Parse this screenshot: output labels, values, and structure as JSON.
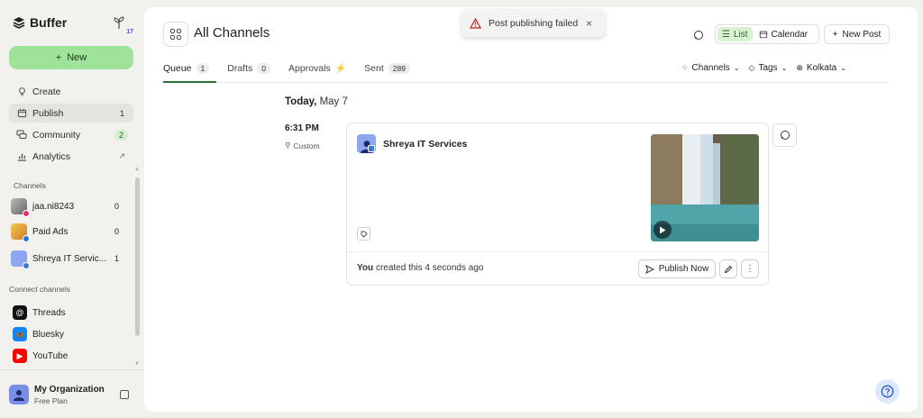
{
  "sidebar": {
    "brand": "Buffer",
    "sprout_badge": "17",
    "new_label": "New",
    "nav": [
      {
        "label": "Create",
        "count": "",
        "icon": "bulb-icon"
      },
      {
        "label": "Publish",
        "count": "1",
        "icon": "calendar-icon"
      },
      {
        "label": "Community",
        "count": "2",
        "icon": "chat-icon"
      },
      {
        "label": "Analytics",
        "count": "",
        "icon": "chart-icon"
      }
    ],
    "channels_heading": "Channels",
    "channels": [
      {
        "name": "jaa.ni8243",
        "count": "0"
      },
      {
        "name": "Paid Ads",
        "count": "0"
      },
      {
        "name": "Shreya IT Servic...",
        "count": "1"
      }
    ],
    "connect_heading": "Connect channels",
    "connect": [
      "Threads",
      "Bluesky",
      "YouTube"
    ],
    "org": {
      "name": "My Organization",
      "plan": "Free Plan"
    }
  },
  "header": {
    "title": "All Channels",
    "toast": "Post publishing failed",
    "view_list": "List",
    "view_calendar": "Calendar",
    "new_post": "New Post"
  },
  "tabs": [
    {
      "label": "Queue",
      "count": "1"
    },
    {
      "label": "Drafts",
      "count": "0"
    },
    {
      "label": "Approvals",
      "count": ""
    },
    {
      "label": "Sent",
      "count": "289"
    }
  ],
  "filters": {
    "channels": "Channels",
    "tags": "Tags",
    "timezone": "Kolkata"
  },
  "queue": {
    "date_today": "Today,",
    "date_rest": "May 7",
    "time": "6:31 PM",
    "time_sub": "Custom",
    "post": {
      "author": "Shreya IT Services",
      "footer_actor": "You",
      "footer_text": "created this 4 seconds ago",
      "publish_label": "Publish Now"
    }
  },
  "colors": {
    "accent_green": "#9fe29a",
    "tab_underline": "#2c6e38",
    "toast_error": "#b42318"
  }
}
